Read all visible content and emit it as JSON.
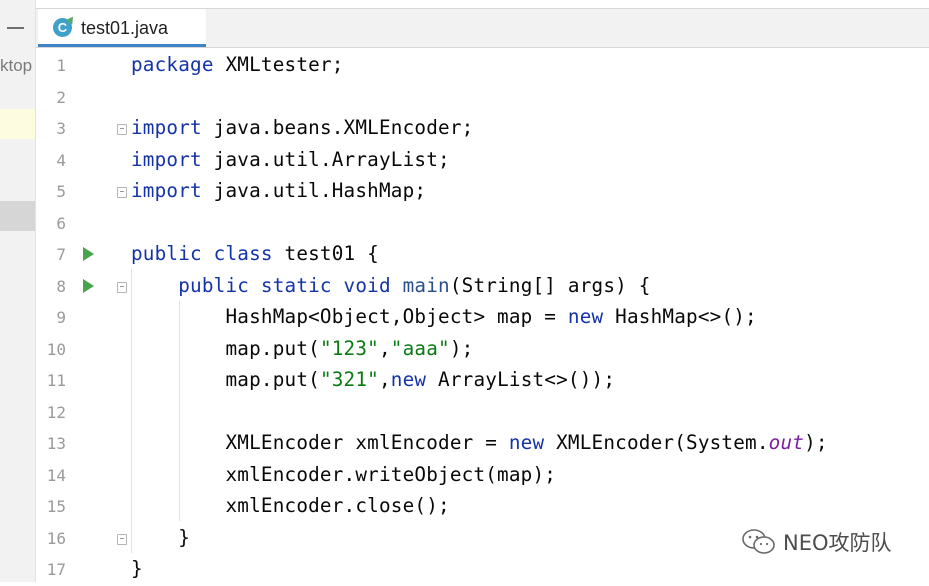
{
  "sidebar": {
    "partial_label": "ktop"
  },
  "tabs": [
    {
      "label": "test01.java",
      "icon": "java-class-icon"
    }
  ],
  "editor": {
    "lines": [
      {
        "n": "1",
        "code": [
          [
            "package",
            "kw"
          ],
          [
            " XMLtester;",
            ""
          ]
        ]
      },
      {
        "n": "2",
        "code": []
      },
      {
        "n": "3",
        "code": [
          [
            "import",
            "kw"
          ],
          [
            " java.beans.XMLEncoder;",
            ""
          ]
        ],
        "fold": true
      },
      {
        "n": "4",
        "code": [
          [
            "import",
            "kw"
          ],
          [
            " java.util.ArrayList;",
            ""
          ]
        ]
      },
      {
        "n": "5",
        "code": [
          [
            "import",
            "kw"
          ],
          [
            " java.util.HashMap;",
            ""
          ]
        ],
        "fold": true
      },
      {
        "n": "6",
        "code": []
      },
      {
        "n": "7",
        "code": [
          [
            "public class",
            "kw"
          ],
          [
            " test01 {",
            ""
          ]
        ],
        "run": true
      },
      {
        "n": "8",
        "code": [
          [
            "    ",
            ""
          ],
          [
            "public static void",
            "kw"
          ],
          [
            " ",
            ""
          ],
          [
            "main",
            "fn"
          ],
          [
            "(String[] args) {",
            ""
          ]
        ],
        "run": true,
        "fold": true
      },
      {
        "n": "9",
        "code": [
          [
            "        HashMap<Object,Object> map = ",
            ""
          ],
          [
            "new",
            "kw"
          ],
          [
            " HashMap<>();",
            ""
          ]
        ]
      },
      {
        "n": "10",
        "code": [
          [
            "        map.put(",
            ""
          ],
          [
            "\"123\"",
            "str"
          ],
          [
            ",",
            ""
          ],
          [
            "\"aaa\"",
            "str"
          ],
          [
            ");",
            ""
          ]
        ]
      },
      {
        "n": "11",
        "code": [
          [
            "        map.put(",
            ""
          ],
          [
            "\"321\"",
            "str"
          ],
          [
            ",",
            ""
          ],
          [
            "new",
            "kw"
          ],
          [
            " ArrayList<>());",
            ""
          ]
        ]
      },
      {
        "n": "12",
        "code": []
      },
      {
        "n": "13",
        "code": [
          [
            "        XMLEncoder xmlEncoder = ",
            ""
          ],
          [
            "new",
            "kw"
          ],
          [
            " XMLEncoder(System.",
            ""
          ],
          [
            "out",
            "fld"
          ],
          [
            ");",
            ""
          ]
        ]
      },
      {
        "n": "14",
        "code": [
          [
            "        xmlEncoder.writeObject(map);",
            ""
          ]
        ]
      },
      {
        "n": "15",
        "code": [
          [
            "        xmlEncoder.close();",
            ""
          ]
        ]
      },
      {
        "n": "16",
        "code": [
          [
            "    }",
            ""
          ]
        ],
        "fold": true
      },
      {
        "n": "17",
        "code": [
          [
            "}",
            ""
          ]
        ]
      }
    ]
  },
  "watermark": {
    "text": "NEO攻防队",
    "icon": "wechat-icon"
  },
  "colors": {
    "keyword": "#1333a8",
    "string": "#0a7a12",
    "method": "#2b4e8c",
    "field": "#7b1fa2",
    "line_number": "#9a9a9a",
    "tab_underline": "#4083c9",
    "run_icon": "#48a34d"
  }
}
